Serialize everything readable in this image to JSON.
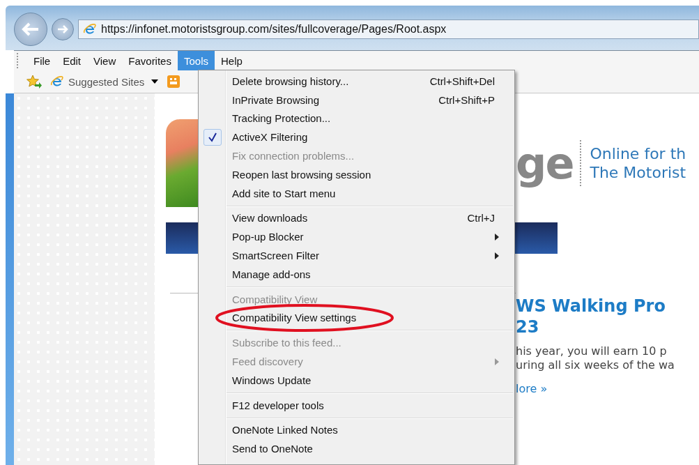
{
  "browser": {
    "address": "https://infonet.motoristsgroup.com/sites/fullcoverage/Pages/Root.aspx"
  },
  "menu_bar": [
    {
      "label": "File",
      "selected": false
    },
    {
      "label": "Edit",
      "selected": false
    },
    {
      "label": "View",
      "selected": false
    },
    {
      "label": "Favorites",
      "selected": false
    },
    {
      "label": "Tools",
      "selected": true
    },
    {
      "label": "Help",
      "selected": false
    }
  ],
  "favorites_bar": {
    "suggested_sites": "Suggested Sites"
  },
  "tools_menu": [
    {
      "kind": "item",
      "label": "Delete browsing history...",
      "shortcut": "Ctrl+Shift+Del",
      "disabled": false,
      "checked": false,
      "submenu": false
    },
    {
      "kind": "item",
      "label": "InPrivate Browsing",
      "shortcut": "Ctrl+Shift+P",
      "disabled": false,
      "checked": false,
      "submenu": false
    },
    {
      "kind": "item",
      "label": "Tracking Protection...",
      "disabled": false,
      "checked": false,
      "submenu": false
    },
    {
      "kind": "item",
      "label": "ActiveX Filtering",
      "disabled": false,
      "checked": true,
      "submenu": false
    },
    {
      "kind": "item",
      "label": "Fix connection problems...",
      "disabled": true,
      "checked": false,
      "submenu": false
    },
    {
      "kind": "item",
      "label": "Reopen last browsing session",
      "disabled": false,
      "checked": false,
      "submenu": false
    },
    {
      "kind": "item",
      "label": "Add site to Start menu",
      "disabled": false,
      "checked": false,
      "submenu": false
    },
    {
      "kind": "separator"
    },
    {
      "kind": "item",
      "label": "View downloads",
      "shortcut": "Ctrl+J",
      "disabled": false,
      "checked": false,
      "submenu": false
    },
    {
      "kind": "item",
      "label": "Pop-up Blocker",
      "disabled": false,
      "checked": false,
      "submenu": true
    },
    {
      "kind": "item",
      "label": "SmartScreen Filter",
      "disabled": false,
      "checked": false,
      "submenu": true
    },
    {
      "kind": "item",
      "label": "Manage add-ons",
      "disabled": false,
      "checked": false,
      "submenu": false
    },
    {
      "kind": "separator"
    },
    {
      "kind": "item",
      "label": "Compatibility View",
      "disabled": true,
      "checked": false,
      "submenu": false
    },
    {
      "kind": "item",
      "label": "Compatibility View settings",
      "disabled": false,
      "checked": false,
      "submenu": false,
      "circled": true
    },
    {
      "kind": "separator"
    },
    {
      "kind": "item",
      "label": "Subscribe to this feed...",
      "disabled": true,
      "checked": false,
      "submenu": false
    },
    {
      "kind": "item",
      "label": "Feed discovery",
      "disabled": true,
      "checked": false,
      "submenu": true
    },
    {
      "kind": "item",
      "label": "Windows Update",
      "disabled": false,
      "checked": false,
      "submenu": false
    },
    {
      "kind": "separator"
    },
    {
      "kind": "item",
      "label": "F12 developer tools",
      "disabled": false,
      "checked": false,
      "submenu": false
    },
    {
      "kind": "separator"
    },
    {
      "kind": "item",
      "label": "OneNote Linked Notes",
      "disabled": false,
      "checked": false,
      "submenu": false
    },
    {
      "kind": "item",
      "label": "Send to OneNote",
      "disabled": false,
      "checked": false,
      "submenu": false
    }
  ],
  "page": {
    "logo_text": "ge",
    "tagline": [
      "Online for th",
      "The Motorist"
    ],
    "headline": [
      "WS Walking Pro",
      "23"
    ],
    "body": [
      "his year, you will earn 10 p",
      "uring all six weeks of the wa"
    ],
    "more_link": "lore »"
  }
}
